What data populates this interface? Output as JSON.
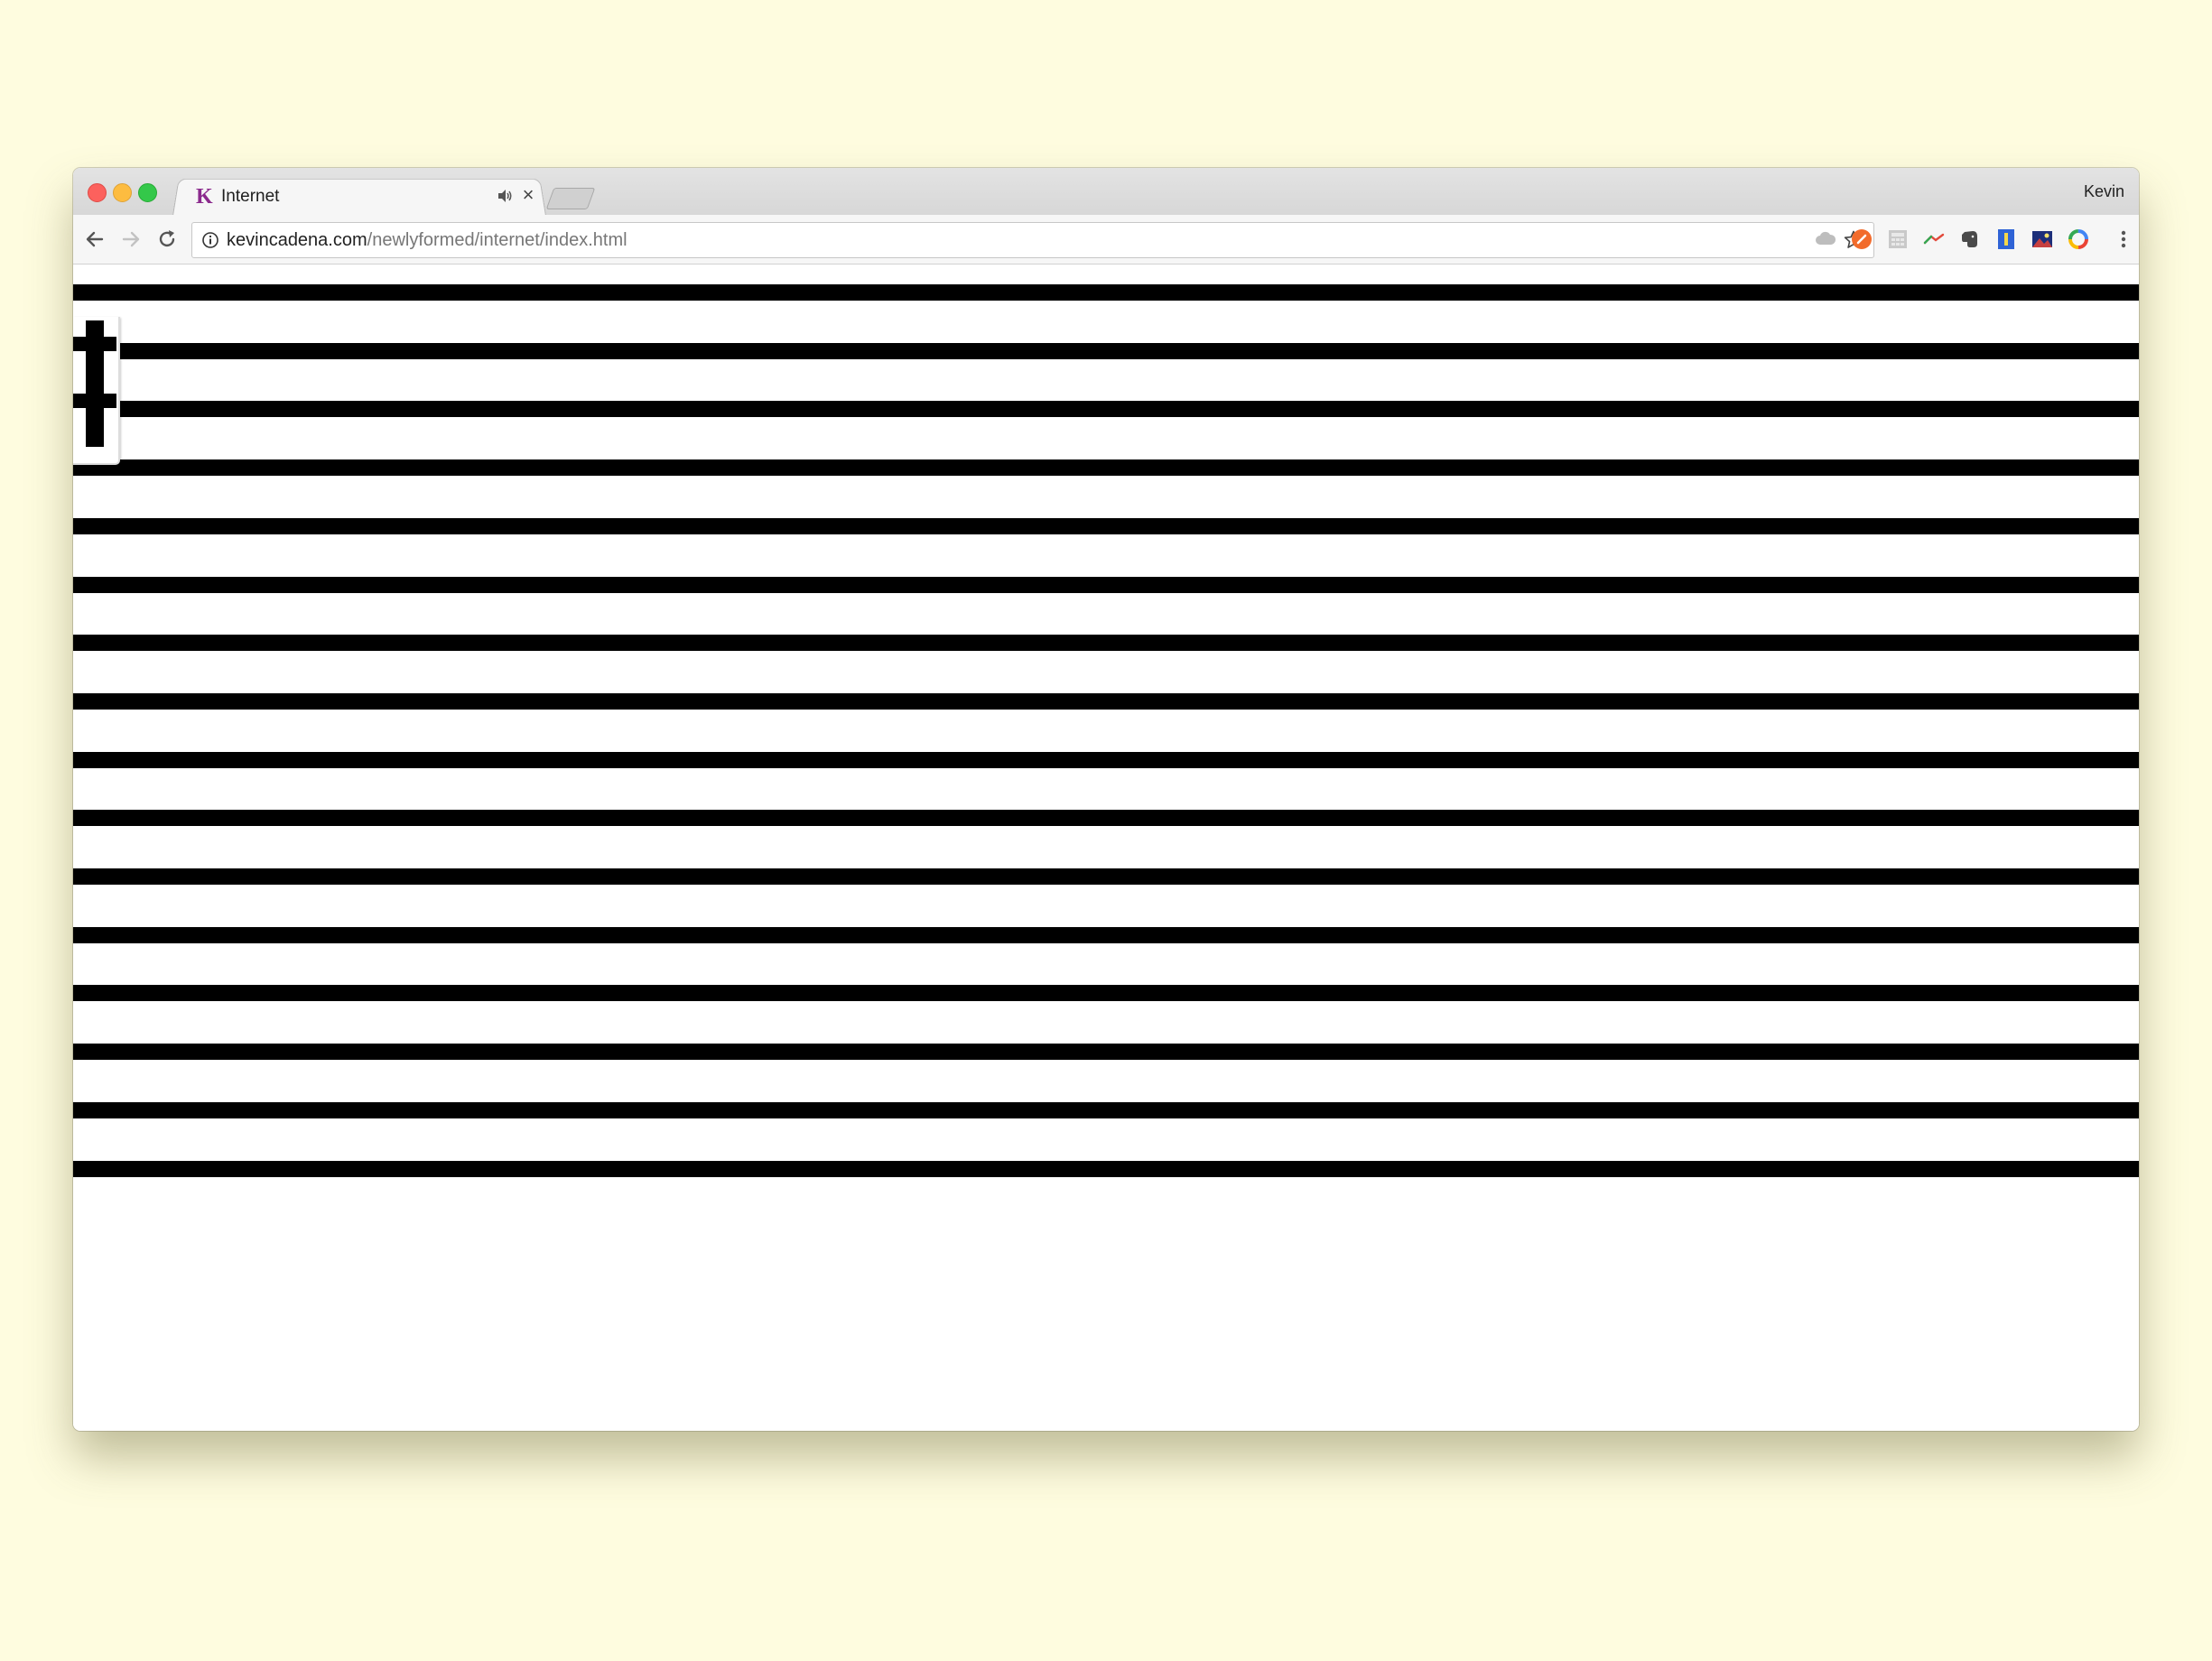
{
  "browser": {
    "tab": {
      "favicon_letter": "K",
      "title": "Internet",
      "close_glyph": "×"
    },
    "profile_name": "Kevin",
    "address_bar": {
      "domain": "kevincadena.com",
      "path": "/newlyformed/internet/index.html"
    },
    "colors": {
      "traffic_close": "#fc615d",
      "traffic_min": "#fdbc40",
      "traffic_max": "#34c84a",
      "desktop_background": "#fefcdf"
    },
    "extensions": [
      "cloud-extension-icon",
      "orange-circle-extension-icon",
      "calculator-extension-icon",
      "chart-extension-icon",
      "evernote-elephant-icon",
      "blue-bookmark-extension-icon",
      "night-image-extension-icon",
      "colorful-circle-extension-icon"
    ]
  },
  "page": {
    "stripe_count": 16,
    "stripe_color": "#000000",
    "background": "#ffffff"
  }
}
